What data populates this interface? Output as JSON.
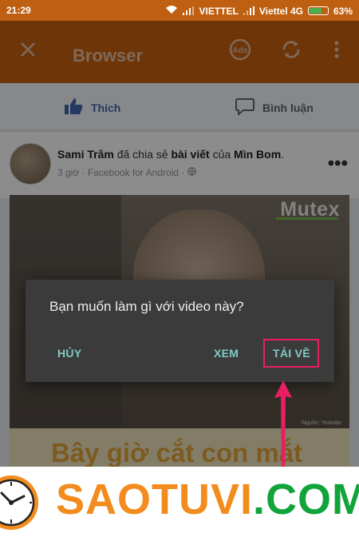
{
  "status_bar": {
    "time": "21:29",
    "carrier1": "VIETTEL",
    "carrier2": "Viettel 4G",
    "battery_percent": "63%",
    "battery_level": 0.63
  },
  "app_bar": {
    "title": "Browser",
    "close_icon": "close-icon",
    "ads_icon": "ads-icon",
    "refresh_icon": "refresh-icon",
    "menu_icon": "more-vert-icon"
  },
  "fb_actions": {
    "like_label": "Thích",
    "comment_label": "Bình luận"
  },
  "post": {
    "author": "Sami Trâm",
    "shared_text": "đã chia sẻ",
    "object": "bài viết",
    "of_text": "của",
    "owner": "Mìn Bom",
    "end": ".",
    "meta": "3 giờ · Facebook for Android ·"
  },
  "video": {
    "watermark": "Mutex",
    "source": "Nguồn: Youtube",
    "caption": "Bây giờ cắt con mắt"
  },
  "dialog": {
    "message": "Bạn muốn làm gì với video này?",
    "cancel_label": "HỦY",
    "view_label": "XEM",
    "download_label": "TẢI VỀ"
  },
  "banner": {
    "brand_main": "SAOTUVI",
    "brand_suffix": ".COM"
  },
  "colors": {
    "app_bar": "#c8610f",
    "dialog_bg": "#3b3b3b",
    "dialog_button": "#80cbc4",
    "highlight": "#e91e63",
    "brand_orange": "#f28c1e",
    "brand_green": "#11a43b"
  }
}
